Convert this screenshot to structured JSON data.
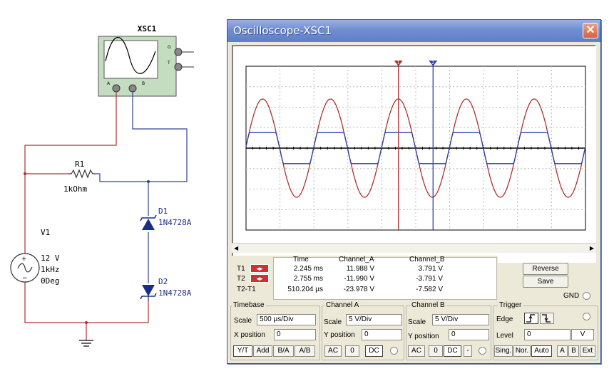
{
  "schematic": {
    "scope_label": "XSC1",
    "scope_pins": {
      "g": "G",
      "t": "T",
      "a": "A",
      "b": "B"
    },
    "r1_name": "R1",
    "r1_value": "1kOhm",
    "d1_name": "D1",
    "d1_model": "1N4728A",
    "d2_name": "D2",
    "d2_model": "1N4728A",
    "v1_name": "V1",
    "v1_voltage": "12 V",
    "v1_freq": "1kHz",
    "v1_phase": "0Deg",
    "colors": {
      "channel_a_wire": "#b03030",
      "channel_b_wire": "#3040a0",
      "component": "#1a2d8a"
    }
  },
  "window": {
    "title": "Oscilloscope-XSC1",
    "close_icon": "close-icon"
  },
  "screen": {
    "colors": {
      "channel_a": "#b03030",
      "channel_b": "#2a3fae",
      "grid": "#bcbcbc"
    },
    "markers": {
      "t1": "1",
      "t2": "2"
    }
  },
  "readout": {
    "headers": {
      "time": "Time",
      "channel_a": "Channel_A",
      "channel_b": "Channel_B"
    },
    "rows": [
      {
        "label": "T1",
        "time": "2.245 ms",
        "a": "11.988 V",
        "b": "3.791 V"
      },
      {
        "label": "T2",
        "time": "2.755 ms",
        "a": "-11.990 V",
        "b": "-3.791 V"
      },
      {
        "label": "T2-T1",
        "time": "510.204 µs",
        "a": "-23.978 V",
        "b": "-7.582 V"
      }
    ],
    "arrow_glyph": "◂▸"
  },
  "buttons": {
    "reverse": "Reverse",
    "save": "Save",
    "gnd": "GND"
  },
  "timebase": {
    "title": "Timebase",
    "scale_label": "Scale",
    "scale_value": "500 µs/Div",
    "xpos_label": "X position",
    "xpos_value": "0",
    "modes": [
      "Y/T",
      "Add",
      "B/A",
      "A/B"
    ]
  },
  "channel_a": {
    "title": "Channel A",
    "scale_label": "Scale",
    "scale_value": "5  V/Div",
    "ypos_label": "Y position",
    "ypos_value": "0",
    "coupling": [
      "AC",
      "0",
      "DC"
    ]
  },
  "channel_b": {
    "title": "Channel B",
    "scale_label": "Scale",
    "scale_value": "5  V/Div",
    "ypos_label": "Y position",
    "ypos_value": "0",
    "coupling": [
      "AC",
      "0",
      "DC",
      "-"
    ]
  },
  "trigger": {
    "title": "Trigger",
    "edge_label": "Edge",
    "level_label": "Level",
    "level_value": "0",
    "level_unit": "V",
    "modes": [
      "Sing.",
      "Nor.",
      "Auto",
      "A",
      "B",
      "Ext"
    ]
  }
}
